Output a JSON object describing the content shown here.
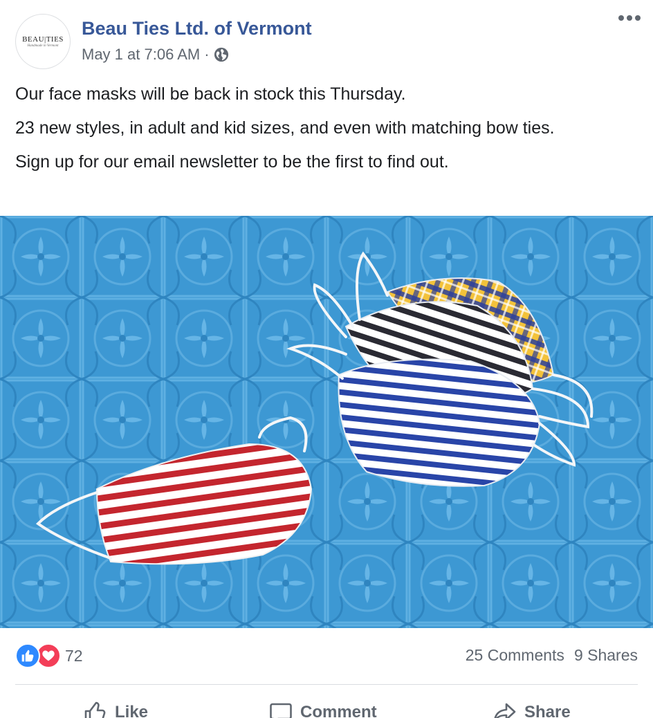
{
  "post": {
    "page_name": "Beau Ties Ltd. of Vermont",
    "timestamp": "May 1 at 7:06 AM",
    "separator": "·",
    "privacy_icon": "globe-icon",
    "avatar": {
      "logo_text": "BEAU|TIES",
      "logo_tagline": "Handmade in Vermont"
    },
    "paragraphs": [
      "Our face masks will be back in stock this Thursday.",
      "23 new styles, in adult and kid sizes, and even with matching bow ties.",
      "Sign up for our email newsletter to be the first to find out."
    ]
  },
  "engagement": {
    "reaction_count": "72",
    "comments": "25 Comments",
    "shares": "9 Shares",
    "reaction_icons": [
      "like-reaction-icon",
      "love-reaction-icon"
    ]
  },
  "actions": {
    "like": "Like",
    "comment": "Comment",
    "share": "Share"
  },
  "colors": {
    "link_blue": "#385898",
    "meta_gray": "#606770",
    "like_blue": "#2e89ff",
    "love_red": "#f33e58",
    "photo_blue": "#3d98d3"
  }
}
